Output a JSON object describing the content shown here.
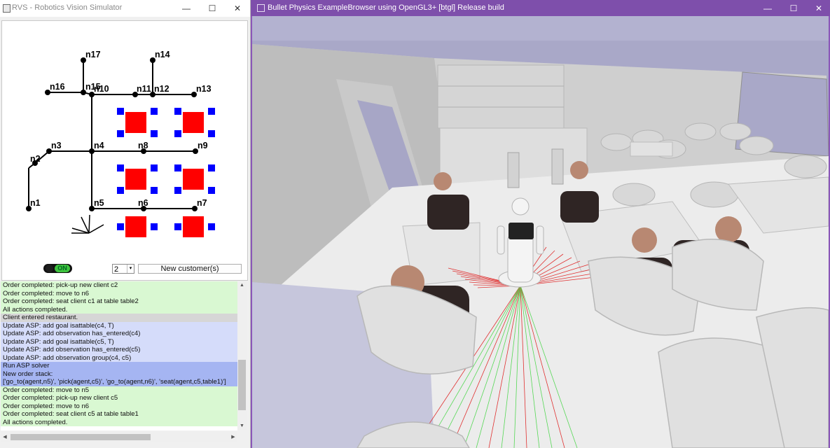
{
  "left_window": {
    "title": "RVS - Robotics Vision Simulator",
    "controls": {
      "minimize": "—",
      "maximize": "☐",
      "close": "✕"
    },
    "map": {
      "nodes": [
        "n1",
        "n2",
        "n3",
        "n4",
        "n5",
        "n6",
        "n7",
        "n8",
        "n9",
        "n10",
        "n11",
        "n12",
        "n13",
        "n14",
        "n15",
        "n16",
        "n17"
      ]
    },
    "toggle": {
      "label": "ON",
      "state": "on"
    },
    "spinner": {
      "value": "2",
      "arrow": "▾"
    },
    "new_customer_label": "New customer(s)",
    "log": [
      {
        "text": "Order completed: pick-up new client c2",
        "color": "green"
      },
      {
        "text": "Order completed: move to n6",
        "color": "green"
      },
      {
        "text": "Order completed: seat client c1 at table table2",
        "color": "green"
      },
      {
        "text": "All actions completed.",
        "color": "green"
      },
      {
        "text": "Client entered restaurant.",
        "color": "gray"
      },
      {
        "text": "Update ASP: add goal isattable(c4, T)",
        "color": "lavender"
      },
      {
        "text": "Update ASP: add observation has_entered(c4)",
        "color": "lavender"
      },
      {
        "text": "Update ASP: add goal isattable(c5, T)",
        "color": "lavender"
      },
      {
        "text": "Update ASP: add observation has_entered(c5)",
        "color": "lavender"
      },
      {
        "text": "Update ASP: add observation group(c4, c5)",
        "color": "lavender"
      },
      {
        "text": "Run ASP solver",
        "color": "blue"
      },
      {
        "text": "New order stack:",
        "color": "blue"
      },
      {
        "text": "['go_to(agent,n5)', 'pick(agent,c5)', 'go_to(agent,n6)', 'seat(agent,c5,table1)']",
        "color": "blue"
      },
      {
        "text": "Order completed: move to n5",
        "color": "green"
      },
      {
        "text": "Order completed: pick-up new client c5",
        "color": "green"
      },
      {
        "text": "Order completed: move to n6",
        "color": "green"
      },
      {
        "text": "Order completed: seat client c5 at table table1",
        "color": "green"
      },
      {
        "text": "All actions completed.",
        "color": "green"
      }
    ],
    "colors": {
      "green": "#d9f8d2",
      "gray": "#d6d6d6",
      "lavender": "#d5dcfa",
      "blue": "#a5b5f2",
      "table": "#ff0000",
      "chair": "#0000ff"
    }
  },
  "right_window": {
    "title": "Bullet Physics ExampleBrowser using OpenGL3+ [btgl] Release build",
    "controls": {
      "minimize": "—",
      "maximize": "☐",
      "close": "✕"
    },
    "colors": {
      "titlebar": "#7e4fab",
      "sky": "#a9a8c8",
      "floor": "#ececec",
      "laser_red": "#e03030",
      "laser_green": "#56d856"
    }
  }
}
